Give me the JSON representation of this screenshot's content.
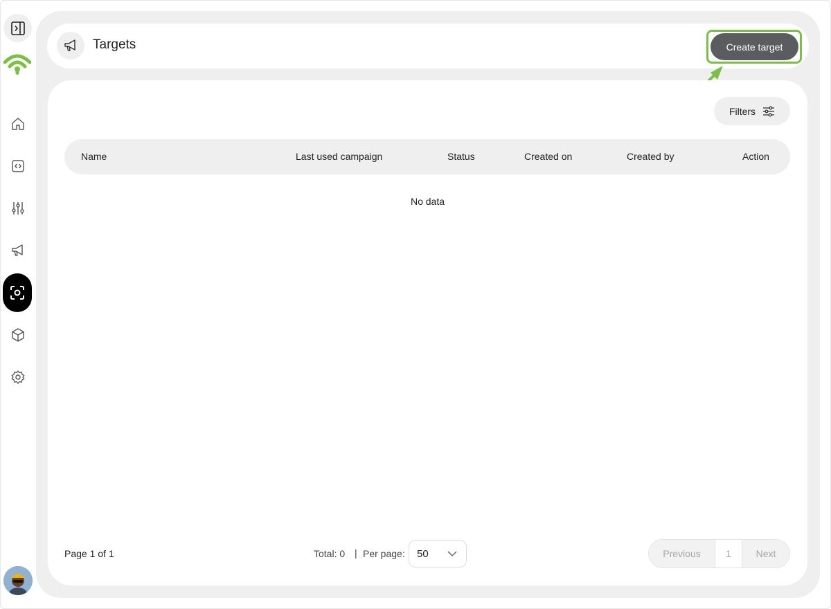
{
  "header": {
    "title": "Targets",
    "icon": "megaphone-icon",
    "create_label": "Create target"
  },
  "sidebar": {
    "items": [
      {
        "icon": "home-icon",
        "active": false
      },
      {
        "icon": "code-icon",
        "active": false
      },
      {
        "icon": "sliders-icon",
        "active": false
      },
      {
        "icon": "megaphone-icon",
        "active": false
      },
      {
        "icon": "scan-focus-icon",
        "active": true
      },
      {
        "icon": "cube-icon",
        "active": false
      },
      {
        "icon": "gear-icon",
        "active": false
      }
    ]
  },
  "filters": {
    "label": "Filters"
  },
  "table": {
    "columns": [
      "Name",
      "Last used campaign",
      "Status",
      "Created on",
      "Created by",
      "Action"
    ],
    "empty_text": "No data"
  },
  "footer": {
    "page_info": "Page 1 of 1",
    "total": "Total: 0",
    "separator": "|",
    "per_page_label": "Per page:",
    "per_page_value": "50",
    "previous": "Previous",
    "current_page": "1",
    "next": "Next"
  },
  "colors": {
    "accent": "#7ac143",
    "primary_button": "#5b5c5f",
    "surface": "#efefef",
    "active_nav": "#000000"
  }
}
